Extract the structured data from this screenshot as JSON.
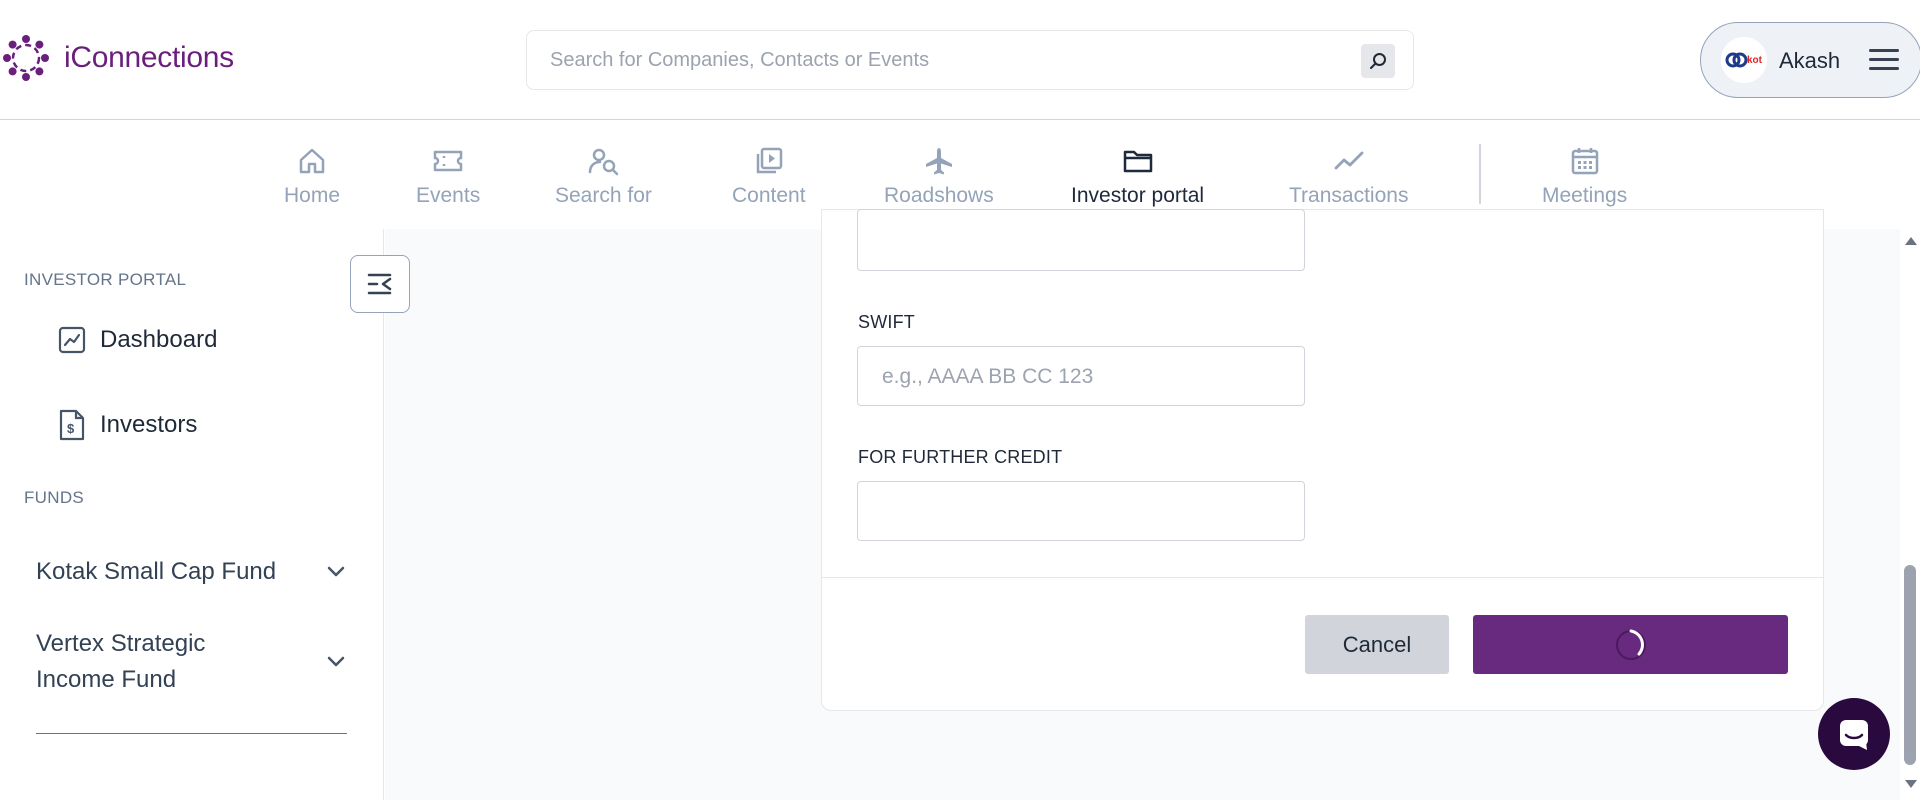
{
  "brand": {
    "name": "iConnections"
  },
  "search": {
    "placeholder": "Search for Companies, Contacts or Events"
  },
  "user": {
    "name": "Akash",
    "avatar_text": "kot"
  },
  "nav": {
    "items": [
      {
        "label": "Home",
        "icon": "home-icon"
      },
      {
        "label": "Events",
        "icon": "ticket-icon"
      },
      {
        "label": "Search for",
        "icon": "user-search-icon"
      },
      {
        "label": "Content",
        "icon": "video-library-icon"
      },
      {
        "label": "Roadshows",
        "icon": "airplane-icon"
      },
      {
        "label": "Investor portal",
        "icon": "folder-icon",
        "active": true
      },
      {
        "label": "Transactions",
        "icon": "trend-line-icon"
      },
      {
        "label": "Meetings",
        "icon": "calendar-icon"
      }
    ]
  },
  "sidebar": {
    "section_investor": "INVESTOR PORTAL",
    "links": [
      {
        "label": "Dashboard",
        "icon": "chart-icon"
      },
      {
        "label": "Investors",
        "icon": "dollar-document-icon"
      }
    ],
    "section_funds": "FUNDS",
    "funds": [
      {
        "label": "Kotak Small Cap Fund"
      },
      {
        "label": "Vertex Strategic Income Fund"
      }
    ]
  },
  "form": {
    "swift_label": "SWIFT",
    "swift_placeholder": "e.g., AAAA BB CC 123",
    "further_credit_label": "FOR FURTHER CREDIT",
    "cancel_label": "Cancel"
  },
  "colors": {
    "brand": "#6b1f7c",
    "primary_button": "#672a7f",
    "nav_active": "#1e293b",
    "nav_inactive": "#94a3b8"
  }
}
